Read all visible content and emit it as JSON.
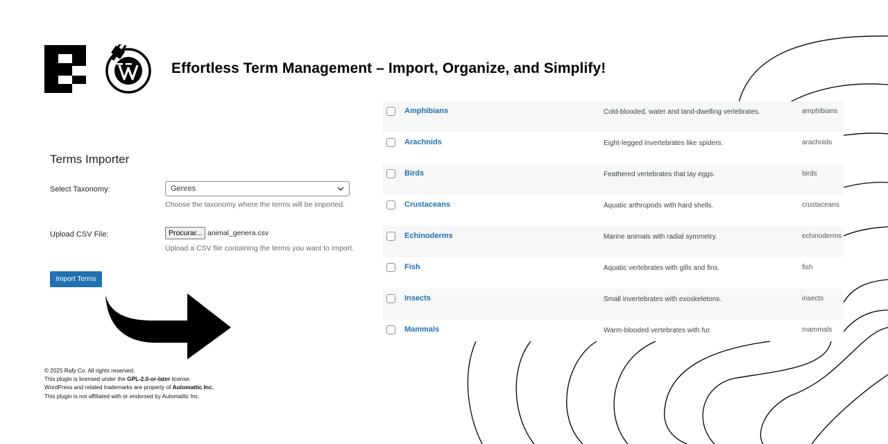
{
  "header": {
    "headline": "Effortless Term Management – Import, Organize, and Simplify!"
  },
  "importer": {
    "title": "Terms Importer",
    "taxonomy_label": "Select Taxonomy:",
    "taxonomy_value": "Genres",
    "taxonomy_help": "Choose the taxonomy where the terms will be imported.",
    "csv_label": "Upload CSV File:",
    "file_button": "Procurar...",
    "file_name": "animal_genera.csv",
    "csv_help": "Upload a CSV file containing the terms you want to import.",
    "import_button": "Import Terms"
  },
  "footer": {
    "copyright": "© 2025 Rafy Co. All rights reserved.",
    "license_prefix": "This plugin is licensed under the ",
    "license_name": "GPL-2.0-or-later",
    "license_suffix": " license.",
    "trademark_prefix": "WordPress and related trademarks are property of ",
    "trademark_owner": "Automattic Inc.",
    "affiliation": "This plugin is not affiliated with or endorsed by Automattic Inc."
  },
  "terms": [
    {
      "name": "Amphibians",
      "description": "Cold-blooded, water and land-dwelling vertebrates.",
      "slug": "amphibians"
    },
    {
      "name": "Arachnids",
      "description": "Eight-legged invertebrates like spiders.",
      "slug": "arachnids"
    },
    {
      "name": "Birds",
      "description": "Feathered vertebrates that lay eggs.",
      "slug": "birds"
    },
    {
      "name": "Crustaceans",
      "description": "Aquatic arthropods with hard shells.",
      "slug": "crustaceans"
    },
    {
      "name": "Echinoderms",
      "description": "Marine animals with radial symmetry.",
      "slug": "echinoderms"
    },
    {
      "name": "Fish",
      "description": "Aquatic vertebrates with gills and fins.",
      "slug": "fish"
    },
    {
      "name": "Insects",
      "description": "Small invertebrates with exoskeletons.",
      "slug": "insects"
    },
    {
      "name": "Mammals",
      "description": "Warm-blooded vertebrates with fur.",
      "slug": "mammals"
    }
  ],
  "colors": {
    "accent": "#2271b1",
    "stripe": "#f6f7f7",
    "text": "#1d2327"
  },
  "icons": [
    "brand-logo-icon",
    "wordpress-plug-icon",
    "chevron-down-icon",
    "curved-arrow-icon"
  ]
}
